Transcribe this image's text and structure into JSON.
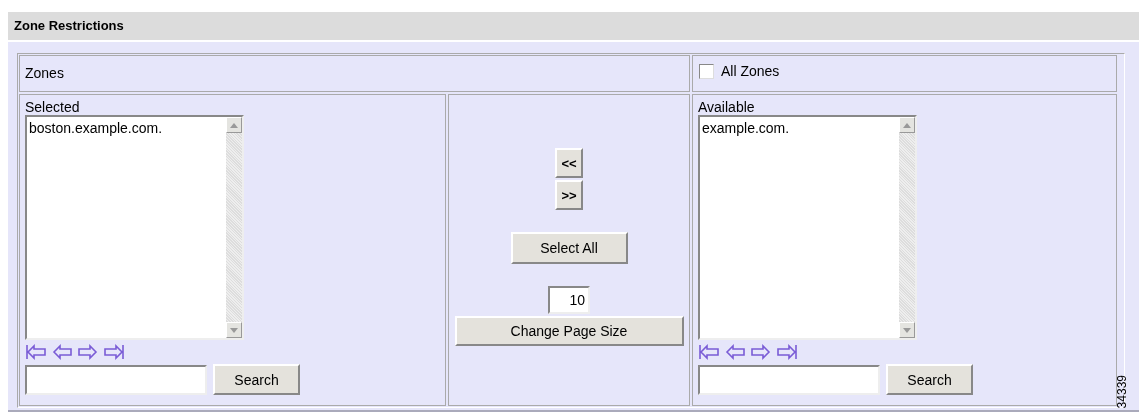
{
  "title": "Zone Restrictions",
  "zones_label": "Zones",
  "all_zones": {
    "label": "All Zones",
    "checked": false
  },
  "panes": [
    {
      "label": "Selected",
      "items": [
        "boston.example.com."
      ],
      "search_button": "Search"
    },
    {
      "label": "Available",
      "items": [
        "example.com."
      ],
      "search_button": "Search"
    }
  ],
  "move_buttons": [
    "<<",
    ">>"
  ],
  "select_all_button": "Select All",
  "page_size": {
    "value": "10",
    "button": "Change Page Size"
  },
  "figure_number": "34339"
}
